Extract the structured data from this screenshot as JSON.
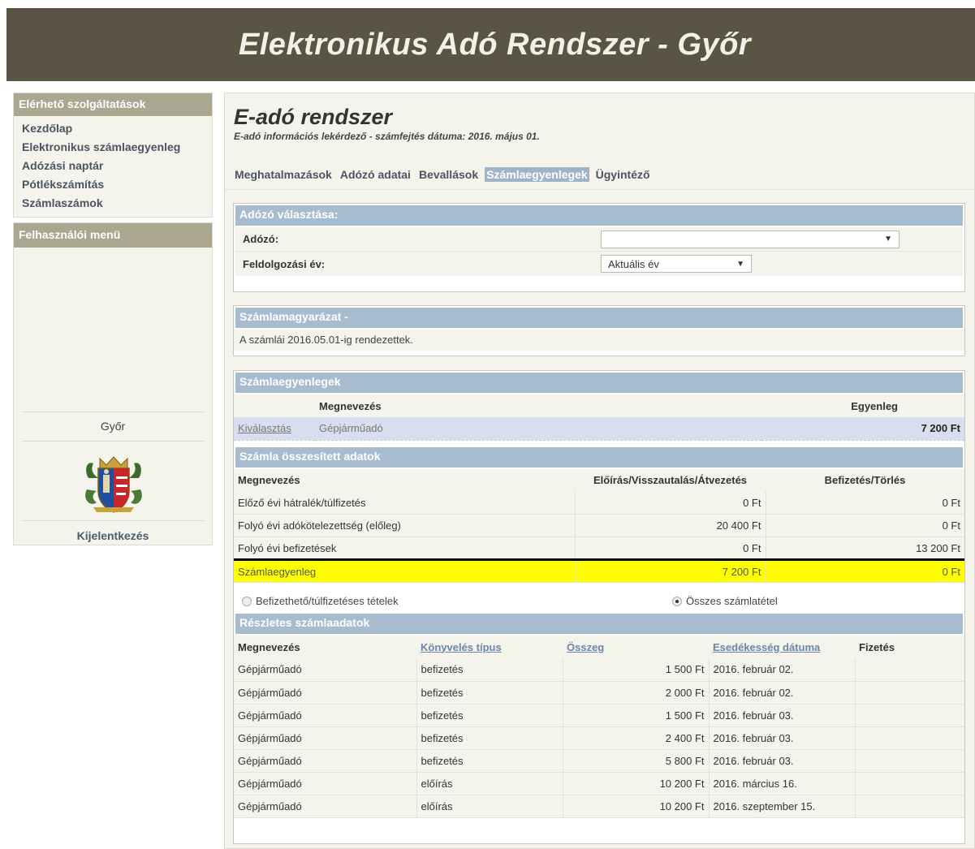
{
  "header": {
    "title": "Elektronikus Adó Rendszer - Győr"
  },
  "sidebar": {
    "services_title": "Elérhető szolgáltatások",
    "services": [
      {
        "label": "Kezdőlap"
      },
      {
        "label": "Elektronikus számlaegyenleg"
      },
      {
        "label": "Adózási naptár"
      },
      {
        "label": "Pótlékszámítás"
      },
      {
        "label": "Számlaszámok"
      }
    ],
    "user_menu_title": "Felhasználói menü",
    "city": "Győr",
    "logout": "Kijelentkezés"
  },
  "main": {
    "title": "E-adó rendszer",
    "subtitle": "E-adó információs lekérdező - számfejtés dátuma: 2016. május 01.",
    "tabs": [
      {
        "label": "Meghatalmazások",
        "active": false
      },
      {
        "label": "Adózó adatai",
        "active": false
      },
      {
        "label": "Bevallások",
        "active": false
      },
      {
        "label": "Számlaegyenlegek",
        "active": true
      },
      {
        "label": "Ügyintéző",
        "active": false
      }
    ]
  },
  "taxpayer": {
    "title": "Adózó választása:",
    "taxpayer_label": "Adózó:",
    "taxpayer_value": "",
    "year_label": "Feldolgozási év:",
    "year_value": "Aktuális év"
  },
  "explanation": {
    "title": "Számlamagyarázat -",
    "text": "A számlái 2016.05.01-ig rendezettek."
  },
  "balances": {
    "title": "Számlaegyenlegek",
    "col_name": "Megnevezés",
    "col_balance": "Egyenleg",
    "rows": [
      {
        "action": "Kiválasztás",
        "name": "Gépjárműadó",
        "balance": "7 200 Ft"
      }
    ]
  },
  "summary": {
    "title": "Számla összesített adatok",
    "headers": [
      "Megnevezés",
      "Előírás/Visszautalás/Átvezetés",
      "Befizetés/Törlés"
    ],
    "rows": [
      {
        "name": "Előző évi hátralék/túlfizetés",
        "charge": "0 Ft",
        "payment": "0 Ft"
      },
      {
        "name": "Folyó évi adókötelezettség (előleg)",
        "charge": "20 400 Ft",
        "payment": "0 Ft"
      },
      {
        "name": "Folyó évi befizetések",
        "charge": "0 Ft",
        "payment": "13 200 Ft"
      }
    ],
    "total": {
      "name": "Számlaegyenleg",
      "charge": "7 200 Ft",
      "payment": "0 Ft"
    },
    "highlight_color": "#ffff00"
  },
  "filter": {
    "option1": "Befizethető/túlfizetéses tételek",
    "option2": "Összes számlatétel",
    "selected": 2
  },
  "details": {
    "title": "Részletes számlaadatok",
    "headers": [
      "Megnevezés",
      "Könyvelés típus",
      "Összeg",
      "Esedékesség dátuma",
      "Fizetés"
    ],
    "rows": [
      {
        "name": "Gépjárműadó",
        "type": "befizetés",
        "amount": "1 500 Ft",
        "due": "2016. február 02.",
        "pay": ""
      },
      {
        "name": "Gépjárműadó",
        "type": "befizetés",
        "amount": "2 000 Ft",
        "due": "2016. február 02.",
        "pay": ""
      },
      {
        "name": "Gépjárműadó",
        "type": "befizetés",
        "amount": "1 500 Ft",
        "due": "2016. február 03.",
        "pay": ""
      },
      {
        "name": "Gépjárműadó",
        "type": "befizetés",
        "amount": "2 400 Ft",
        "due": "2016. február 03.",
        "pay": ""
      },
      {
        "name": "Gépjárműadó",
        "type": "befizetés",
        "amount": "5 800 Ft",
        "due": "2016. február 03.",
        "pay": ""
      },
      {
        "name": "Gépjárműadó",
        "type": "előírás",
        "amount": "10 200 Ft",
        "due": "2016. március 16.",
        "pay": ""
      },
      {
        "name": "Gépjárműadó",
        "type": "előírás",
        "amount": "10 200 Ft",
        "due": "2016. szeptember 15.",
        "pay": ""
      }
    ]
  },
  "colors": {
    "header_bg": "#5a5444",
    "sidebar_title_bg": "#aba68f",
    "panel_head_bg": "#a8bccf",
    "active_tab_bg": "#9fb4c8"
  }
}
